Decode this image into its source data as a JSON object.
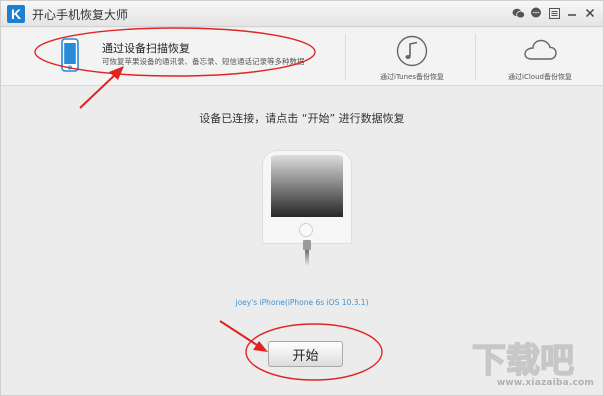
{
  "window": {
    "title": "开心手机恢复大师",
    "logo_letter": "K",
    "controls": [
      "wechat-icon",
      "chat-icon",
      "menu-icon",
      "minimize-icon",
      "close-icon"
    ]
  },
  "tabs": {
    "device_scan": {
      "title": "通过设备扫描恢复",
      "description": "可恢复苹果设备的通讯录、备忘录、短信通话记录等多种数据",
      "icon": "phone-icon",
      "active": true
    },
    "itunes": {
      "label": "通过iTunes备份恢复",
      "icon": "music-note-icon"
    },
    "icloud": {
      "label": "通过iCloud备份恢复",
      "icon": "cloud-icon"
    }
  },
  "main": {
    "instruction": "设备已连接，请点击 “开始” 进行数据恢复",
    "device_info": "joey's iPhone(iPhone 6s iOS 10.3.1)",
    "start_button": "开始"
  },
  "watermark": {
    "text": "www.xiazaiba.com"
  },
  "colors": {
    "accent_blue": "#1e7fd0",
    "link_blue": "#3f93d4",
    "annotation_red": "#e02424",
    "background": "#ececec"
  }
}
